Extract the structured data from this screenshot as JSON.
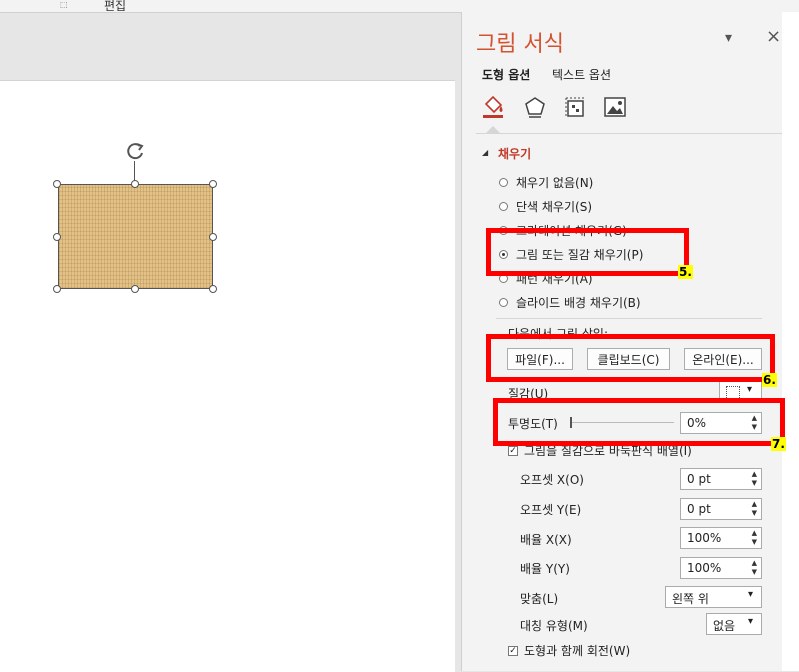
{
  "ribbon": {
    "group_label": "편집",
    "launcher_icon": "dialog-launcher-icon"
  },
  "panel": {
    "title": "그림 서식",
    "dropdown_icon": "▾",
    "close_icon": "×",
    "tabs": [
      "도형 옵션",
      "텍스트 옵션"
    ],
    "icon_tabs": [
      "fill-line-icon",
      "effects-icon",
      "size-properties-icon",
      "picture-icon"
    ],
    "section": "채우기",
    "fill_options": [
      {
        "label": "채우기 없음(N)",
        "selected": false
      },
      {
        "label": "단색 채우기(S)",
        "selected": false
      },
      {
        "label": "그라데이션 채우기(G)",
        "selected": false
      },
      {
        "label": "그림 또는 질감 채우기(P)",
        "selected": true
      },
      {
        "label": "패턴 채우기(A)",
        "selected": false
      },
      {
        "label": "슬라이드 배경 채우기(B)",
        "selected": false
      }
    ],
    "insert_from_label": "다음에서 그림 삽입:",
    "buttons": {
      "file": "파일(F)...",
      "clipboard": "클립보드(C)",
      "online": "온라인(E)..."
    },
    "texture_label": "질감(U)",
    "transparency_label": "투명도(T)",
    "transparency_value": "0%",
    "tile_label": "그림을 질감으로 바둑판식 배열(I)",
    "tile_checked": true,
    "offset_x_label": "오프셋 X(O)",
    "offset_x_value": "0 pt",
    "offset_y_label": "오프셋 Y(E)",
    "offset_y_value": "0 pt",
    "scale_x_label": "배율 X(X)",
    "scale_x_value": "100%",
    "scale_y_label": "배율 Y(Y)",
    "scale_y_value": "100%",
    "align_label": "맞춤(L)",
    "align_value": "왼쪽 위",
    "mirror_label": "대칭 유형(M)",
    "mirror_value": "없음",
    "rotate_label": "도형과 함께 회전(W)",
    "rotate_checked": true
  },
  "annotations": [
    "5.",
    "6.",
    "7."
  ],
  "colors": {
    "accent": "#d35230",
    "highlight": "#ff0000",
    "badge": "#ffff00"
  }
}
